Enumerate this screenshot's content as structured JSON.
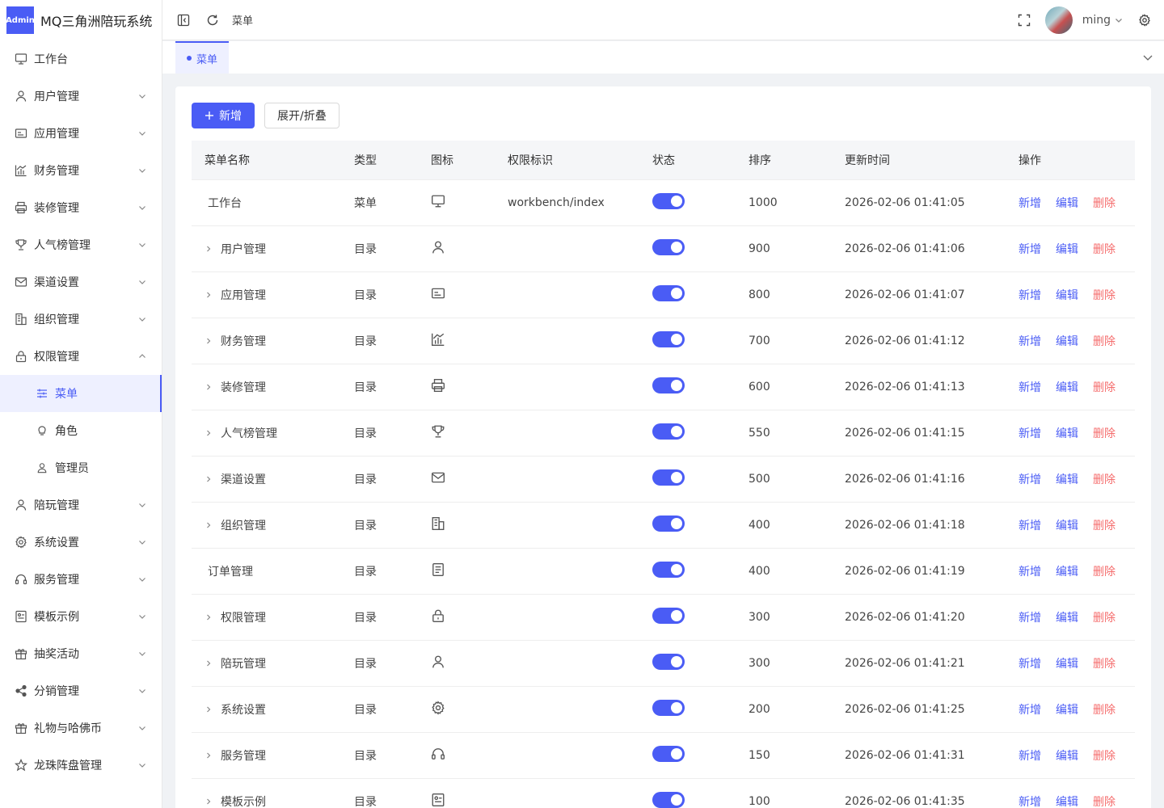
{
  "app": {
    "logo_badge": "Admin",
    "title": "MQ三角洲陪玩系统"
  },
  "sidebar": {
    "items": [
      {
        "label": "工作台",
        "icon": "monitor-icon",
        "has_arrow": false
      },
      {
        "label": "用户管理",
        "icon": "user-icon",
        "has_arrow": true
      },
      {
        "label": "应用管理",
        "icon": "card-icon",
        "has_arrow": true
      },
      {
        "label": "财务管理",
        "icon": "chart-icon",
        "has_arrow": true
      },
      {
        "label": "装修管理",
        "icon": "printer-icon",
        "has_arrow": true
      },
      {
        "label": "人气榜管理",
        "icon": "trophy-icon",
        "has_arrow": true
      },
      {
        "label": "渠道设置",
        "icon": "mail-icon",
        "has_arrow": true
      },
      {
        "label": "组织管理",
        "icon": "building-icon",
        "has_arrow": true
      },
      {
        "label": "权限管理",
        "icon": "lock-icon",
        "has_arrow": true,
        "expanded": true
      }
    ],
    "sub_items": [
      {
        "label": "菜单",
        "icon": "sliders-icon",
        "active": true
      },
      {
        "label": "角色",
        "icon": "bulb-icon"
      },
      {
        "label": "管理员",
        "icon": "user-small-icon"
      }
    ],
    "items_after": [
      {
        "label": "陪玩管理",
        "icon": "user-icon"
      },
      {
        "label": "系统设置",
        "icon": "gear-icon"
      },
      {
        "label": "服务管理",
        "icon": "headset-icon"
      },
      {
        "label": "模板示例",
        "icon": "template-icon"
      },
      {
        "label": "抽奖活动",
        "icon": "gift-icon"
      },
      {
        "label": "分销管理",
        "icon": "share-icon"
      },
      {
        "label": "礼物与哈佛币",
        "icon": "gift-icon"
      },
      {
        "label": "龙珠阵盘管理",
        "icon": "star-icon"
      }
    ]
  },
  "header": {
    "breadcrumb": "菜单",
    "username": "ming"
  },
  "tabs": [
    {
      "label": "菜单",
      "active": true
    }
  ],
  "toolbar": {
    "add_label": "新增",
    "toggle_label": "展开/折叠"
  },
  "table": {
    "columns": [
      "菜单名称",
      "类型",
      "图标",
      "权限标识",
      "状态",
      "排序",
      "更新时间",
      "操作"
    ],
    "ops": {
      "add": "新增",
      "edit": "编辑",
      "delete": "删除"
    },
    "rows": [
      {
        "name": "工作台",
        "expandable": false,
        "type": "菜单",
        "icon": "monitor-icon",
        "perm": "workbench/index",
        "status": true,
        "sort": "1000",
        "time": "2026-02-06 01:41:05"
      },
      {
        "name": "用户管理",
        "expandable": true,
        "type": "目录",
        "icon": "user-icon",
        "perm": "",
        "status": true,
        "sort": "900",
        "time": "2026-02-06 01:41:06"
      },
      {
        "name": "应用管理",
        "expandable": true,
        "type": "目录",
        "icon": "card-icon",
        "perm": "",
        "status": true,
        "sort": "800",
        "time": "2026-02-06 01:41:07"
      },
      {
        "name": "财务管理",
        "expandable": true,
        "type": "目录",
        "icon": "chart-icon",
        "perm": "",
        "status": true,
        "sort": "700",
        "time": "2026-02-06 01:41:12"
      },
      {
        "name": "装修管理",
        "expandable": true,
        "type": "目录",
        "icon": "printer-icon",
        "perm": "",
        "status": true,
        "sort": "600",
        "time": "2026-02-06 01:41:13"
      },
      {
        "name": "人气榜管理",
        "expandable": true,
        "type": "目录",
        "icon": "trophy-icon",
        "perm": "",
        "status": true,
        "sort": "550",
        "time": "2026-02-06 01:41:15"
      },
      {
        "name": "渠道设置",
        "expandable": true,
        "type": "目录",
        "icon": "mail-icon",
        "perm": "",
        "status": true,
        "sort": "500",
        "time": "2026-02-06 01:41:16"
      },
      {
        "name": "组织管理",
        "expandable": true,
        "type": "目录",
        "icon": "building-icon",
        "perm": "",
        "status": true,
        "sort": "400",
        "time": "2026-02-06 01:41:18"
      },
      {
        "name": "订单管理",
        "expandable": false,
        "type": "目录",
        "icon": "document-icon",
        "perm": "",
        "status": true,
        "sort": "400",
        "time": "2026-02-06 01:41:19"
      },
      {
        "name": "权限管理",
        "expandable": true,
        "type": "目录",
        "icon": "lock-icon",
        "perm": "",
        "status": true,
        "sort": "300",
        "time": "2026-02-06 01:41:20"
      },
      {
        "name": "陪玩管理",
        "expandable": true,
        "type": "目录",
        "icon": "user-icon",
        "perm": "",
        "status": true,
        "sort": "300",
        "time": "2026-02-06 01:41:21"
      },
      {
        "name": "系统设置",
        "expandable": true,
        "type": "目录",
        "icon": "gear-icon",
        "perm": "",
        "status": true,
        "sort": "200",
        "time": "2026-02-06 01:41:25"
      },
      {
        "name": "服务管理",
        "expandable": true,
        "type": "目录",
        "icon": "headset-icon",
        "perm": "",
        "status": true,
        "sort": "150",
        "time": "2026-02-06 01:41:31"
      },
      {
        "name": "模板示例",
        "expandable": true,
        "type": "目录",
        "icon": "template-icon",
        "perm": "",
        "status": true,
        "sort": "100",
        "time": "2026-02-06 01:41:35"
      }
    ]
  },
  "colors": {
    "primary": "#4a5cf5",
    "danger": "#f56c6c"
  }
}
